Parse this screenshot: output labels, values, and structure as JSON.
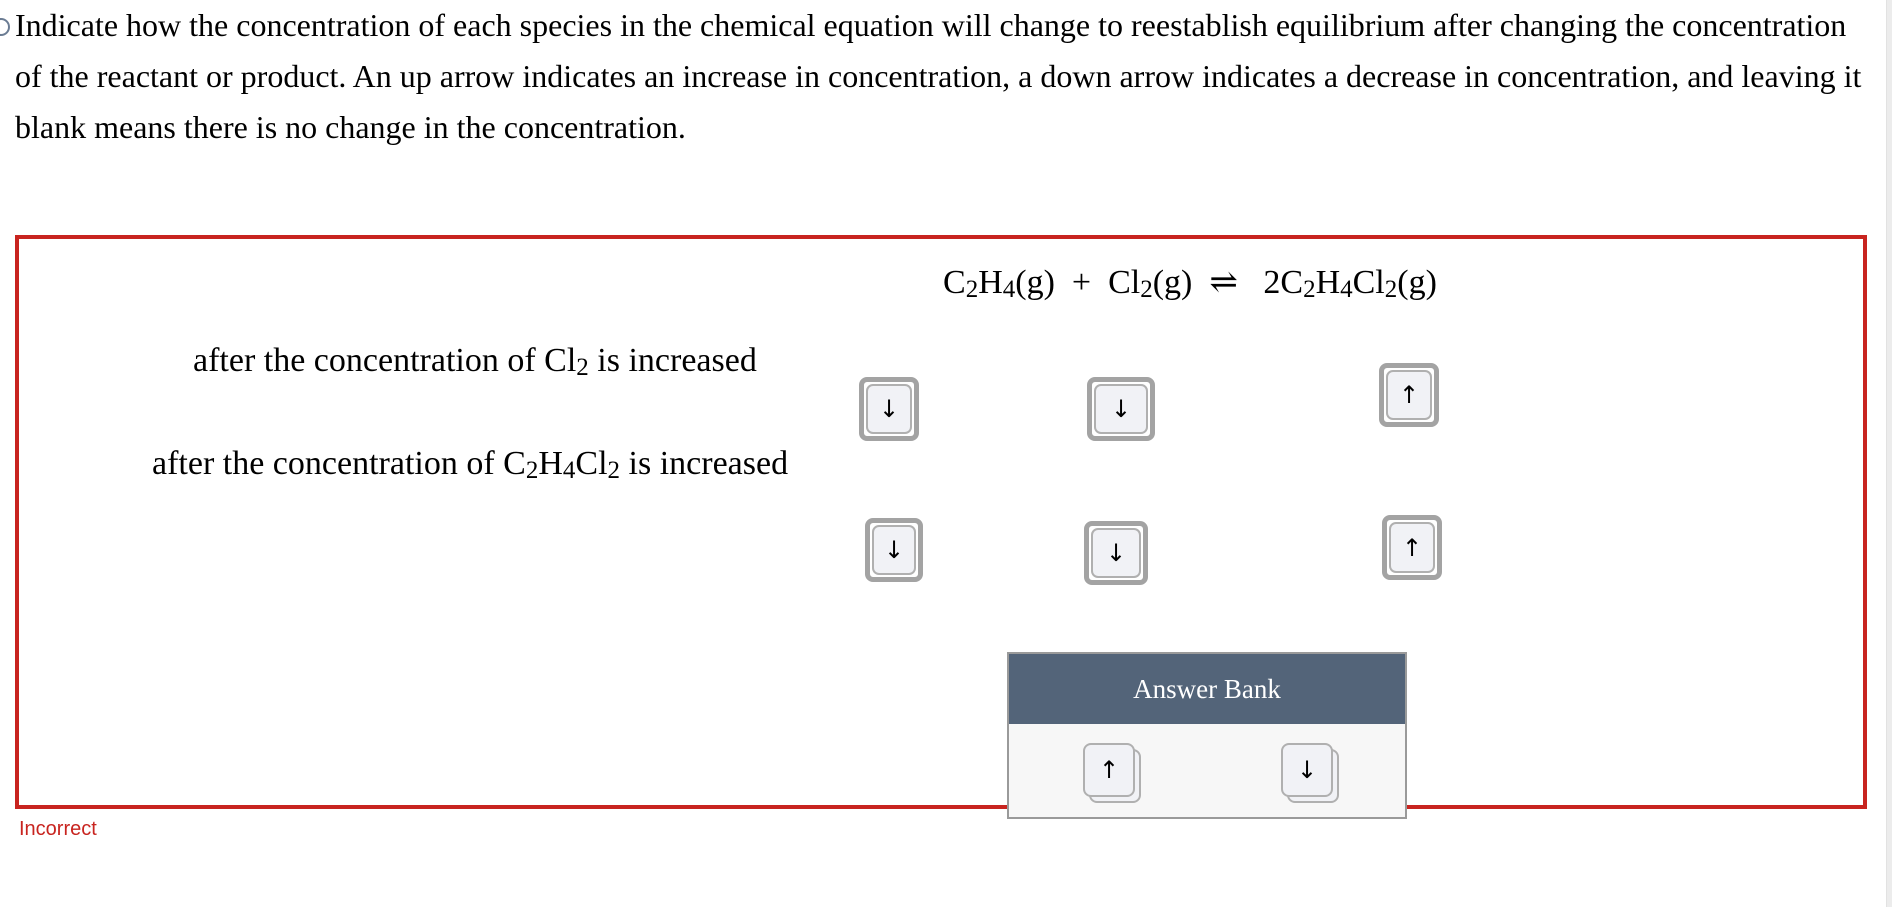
{
  "prompt": {
    "text": "Indicate how the concentration of each species in the chemical equation will change to reestablish equilibrium after changing the concentration of the reactant or product. An up arrow indicates an increase in concentration, a down arrow indicates a decrease in concentration, and leaving it blank means there is no change in the concentration."
  },
  "equation": {
    "r1": {
      "a": "C",
      "s1": "2",
      "b": "H",
      "s2": "4",
      "phase": "(g)"
    },
    "plus": "+",
    "r2": {
      "a": "Cl",
      "s1": "2",
      "phase": "(g)"
    },
    "arrow": "⇌",
    "p1": {
      "coef": "2",
      "a": "C",
      "s1": "2",
      "b": "H",
      "s2": "4",
      "c": "Cl",
      "s3": "2",
      "phase": "(g)"
    }
  },
  "rows": [
    {
      "label_pre": "after the concentration of ",
      "species": {
        "a": "Cl",
        "s1": "2"
      },
      "label_post": " is increased",
      "answers": [
        {
          "icon": "down-arrow-icon",
          "glyph": "↓"
        },
        {
          "icon": "down-arrow-icon",
          "glyph": "↓"
        },
        {
          "icon": "up-arrow-icon",
          "glyph": "↑"
        }
      ]
    },
    {
      "label_pre": "after the concentration of ",
      "species": {
        "a": "C",
        "s1": "2",
        "b": "H",
        "s2": "4",
        "c": "Cl",
        "s3": "2"
      },
      "label_post": " is increased",
      "answers": [
        {
          "icon": "down-arrow-icon",
          "glyph": "↓"
        },
        {
          "icon": "down-arrow-icon",
          "glyph": "↓"
        },
        {
          "icon": "up-arrow-icon",
          "glyph": "↑"
        }
      ]
    }
  ],
  "answer_bank": {
    "title": "Answer Bank",
    "items": [
      {
        "icon": "up-arrow-icon",
        "glyph": "↑"
      },
      {
        "icon": "down-arrow-icon",
        "glyph": "↓"
      }
    ]
  },
  "status": {
    "text": "Incorrect",
    "color": "#c8241f"
  },
  "colors": {
    "frame": "#c8241f",
    "bank_header": "#536479",
    "tile_bg": "#f1f2f6"
  }
}
